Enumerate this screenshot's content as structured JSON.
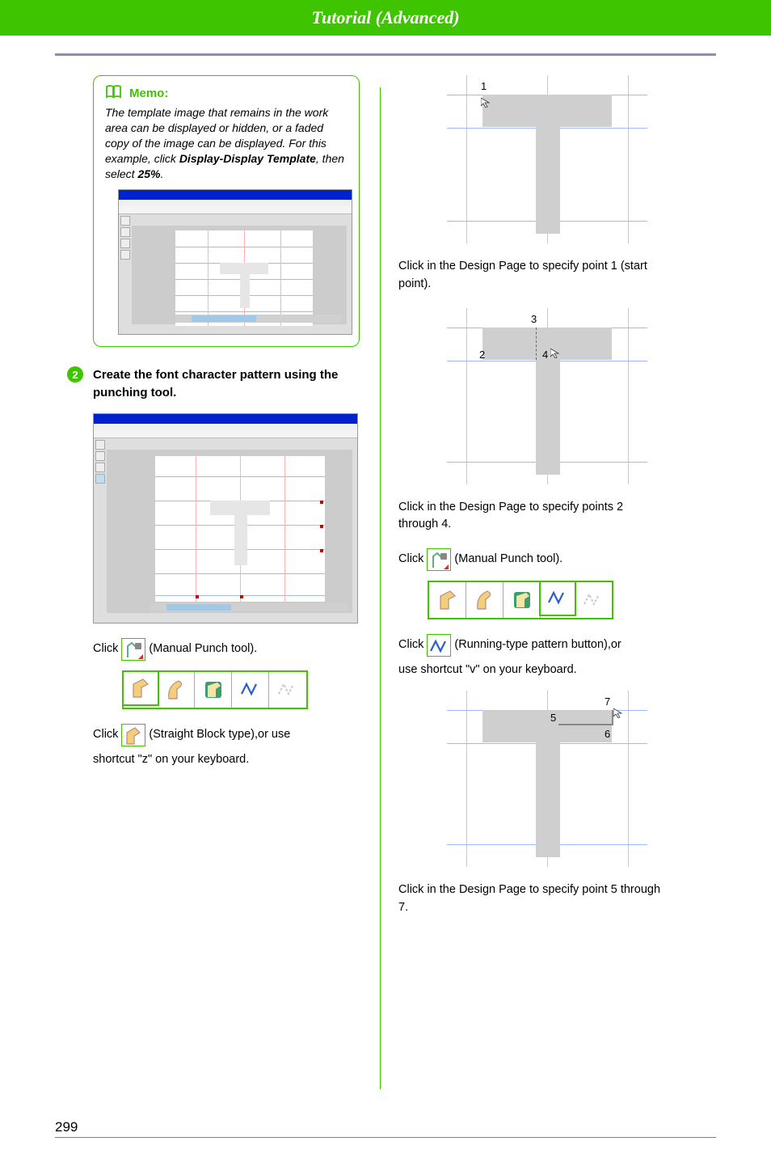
{
  "header": {
    "title": "Tutorial (Advanced)"
  },
  "memo": {
    "label": "Memo:",
    "text_pre": "The template image that remains in the work area can be displayed or hidden, or a faded copy of the image can be displayed. For this example, click ",
    "bold1": "Display-Display Template",
    "mid": ", then select ",
    "bold2": "25%",
    "suffix": "."
  },
  "step2": {
    "num": "2",
    "title": "Create the font character pattern using the punching tool."
  },
  "left": {
    "click": "Click",
    "manual_punch": " (Manual Punch tool).",
    "straight_lead": " (Straight Block type),or use",
    "straight_tail": "shortcut \"z\" on your keyboard."
  },
  "right": {
    "d1_label1": "1",
    "caption_d1": "Click in the Design Page to specify point 1 (start point).",
    "d2_label2": "2",
    "d2_label3": "3",
    "d2_label4": "4",
    "caption_d2": "Click in the Design Page to specify points 2 through 4.",
    "click": "Click",
    "manual_punch": " (Manual Punch tool).",
    "running_lead": " (Running-type pattern button),or",
    "running_tail": "use shortcut \"v\" on your keyboard.",
    "d3_label5": "5",
    "d3_label6": "6",
    "d3_label7": "7",
    "caption_d3": "Click in the Design Page to specify point 5 through 7."
  },
  "page_number": "299"
}
